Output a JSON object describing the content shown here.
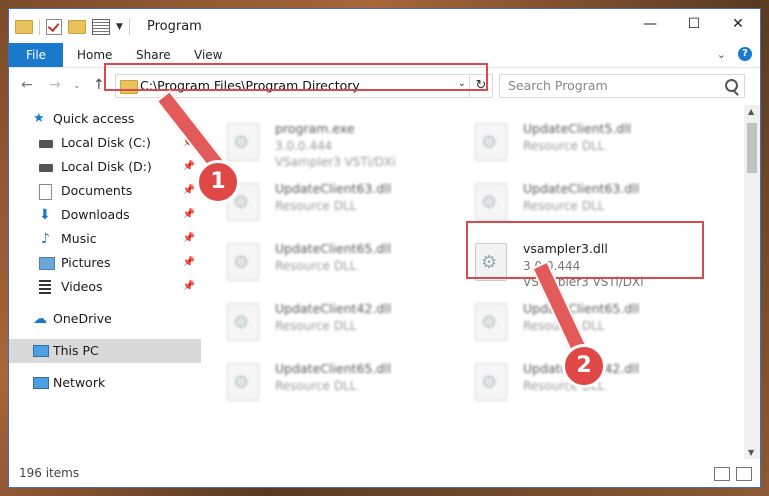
{
  "window": {
    "title": "Program",
    "controls": [
      "—",
      "☐",
      "✕"
    ]
  },
  "ribbon": {
    "tabs": [
      "File",
      "Home",
      "Share",
      "View"
    ]
  },
  "nav": {
    "address": "C:\\Program Files\\Program Directory",
    "search_placeholder": "Search Program"
  },
  "sidebar": {
    "items": [
      {
        "label": "Quick access",
        "icon": "star-icon"
      },
      {
        "label": "Local Disk (C:)",
        "icon": "drive-icon",
        "pinned": true
      },
      {
        "label": "Local Disk (D:)",
        "icon": "drive-icon",
        "pinned": true
      },
      {
        "label": "Documents",
        "icon": "documents-icon",
        "pinned": true
      },
      {
        "label": "Downloads",
        "icon": "download-icon",
        "pinned": true
      },
      {
        "label": "Music",
        "icon": "music-icon",
        "pinned": true
      },
      {
        "label": "Pictures",
        "icon": "pictures-icon",
        "pinned": true
      },
      {
        "label": "Videos",
        "icon": "video-icon",
        "pinned": true
      },
      {
        "label": "OneDrive",
        "icon": "cloud-icon"
      },
      {
        "label": "This PC",
        "icon": "computer-icon",
        "selected": true
      },
      {
        "label": "Network",
        "icon": "network-icon"
      }
    ]
  },
  "files": [
    {
      "name": "program.exe",
      "line1": "3.0.0.444",
      "line2": "VSampler3 VSTi/DXi"
    },
    {
      "name": "UpdateClient5.dll",
      "line1": "Resource DLL",
      "line2": ""
    },
    {
      "name": "UpdateClient63.dll",
      "line1": "Resource DLL",
      "line2": ""
    },
    {
      "name": "UpdateClient63.dll",
      "line1": "Resource DLL",
      "line2": ""
    },
    {
      "name": "UpdateClient65.dll",
      "line1": "Resource DLL",
      "line2": ""
    },
    {
      "name": "vsampler3.dll",
      "line1": "3.0.0.444",
      "line2": "VSampler3 VSTi/DXi"
    },
    {
      "name": "UpdateClient42.dll",
      "line1": "Resource DLL",
      "line2": ""
    },
    {
      "name": "UpdateClient65.dll",
      "line1": "Resource DLL",
      "line2": ""
    },
    {
      "name": "UpdateClient65.dll",
      "line1": "Resource DLL",
      "line2": ""
    },
    {
      "name": "UpdateClient42.dll",
      "line1": "Resource DLL",
      "line2": ""
    }
  ],
  "status": {
    "items_count": "196 items"
  },
  "annotations": {
    "badge1": "1",
    "badge2": "2"
  },
  "colors": {
    "accent": "#1979ca",
    "highlight": "#d94a4a"
  }
}
